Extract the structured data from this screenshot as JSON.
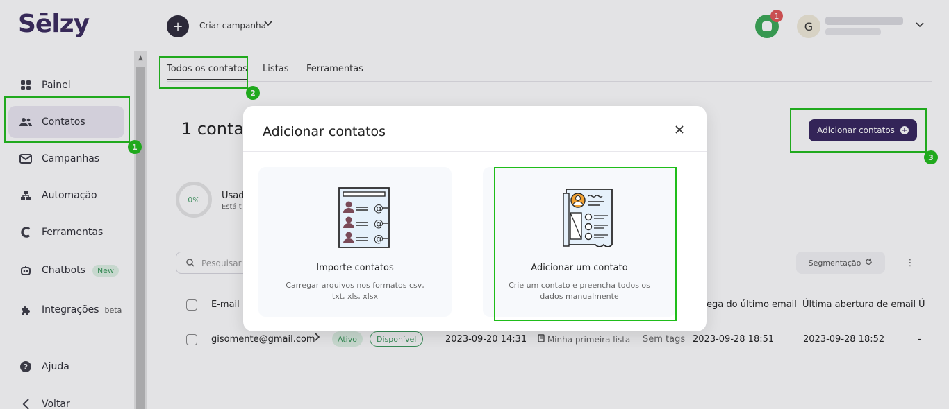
{
  "brand": {
    "logo_text": "Sēlzy"
  },
  "sidebar": {
    "items": [
      {
        "label": "Painel",
        "icon": "grid-icon"
      },
      {
        "label": "Contatos",
        "icon": "users-icon"
      },
      {
        "label": "Campanhas",
        "icon": "mail-icon"
      },
      {
        "label": "Automação",
        "icon": "flow-icon"
      },
      {
        "label": "Ferramentas",
        "icon": "tools-icon"
      },
      {
        "label": "Chatbots",
        "icon": "bot-icon",
        "badge": "New"
      },
      {
        "label": "Integrações",
        "icon": "puzzle-icon",
        "badge": "beta"
      },
      {
        "label": "Ajuda",
        "icon": "help-icon"
      },
      {
        "label": "Voltar",
        "icon": "back-icon"
      }
    ]
  },
  "topbar": {
    "create_label": "Criar campanha",
    "notification_count": "1",
    "avatar_initial": "G"
  },
  "tabs": [
    "Todos os contatos",
    "Listas",
    "Ferramentas"
  ],
  "main": {
    "heading": "1 conta",
    "add_button": "Adicionar contatos",
    "usage": {
      "percent": "0%",
      "title": "Usad",
      "sub": "Está t"
    },
    "search_placeholder": "Pesquisar",
    "segmentation": "Segmentação"
  },
  "table": {
    "columns": [
      "E-mail",
      "rega do último email",
      "Última abertura de email",
      "Ú"
    ],
    "row": {
      "email": "gisomente@gmail.com",
      "status": "Ativo",
      "availability": "Disponível",
      "date_added": "2023-09-20 14:31",
      "list": "Minha primeira lista",
      "tags": "Sem tags",
      "last_delivery": "2023-09-28 18:51",
      "last_open": "2023-09-28 18:52",
      "last_col": "-"
    }
  },
  "modal": {
    "title": "Adicionar contatos",
    "options": [
      {
        "title": "Importe contatos",
        "desc": "Carregar arquivos nos formatos csv, txt, xls, xlsx"
      },
      {
        "title": "Adicionar um contato",
        "desc": "Crie um contato e preencha todos os dados manualmente"
      }
    ]
  },
  "annotations": [
    "1",
    "2",
    "3"
  ],
  "colors": {
    "brand": "#35245e",
    "highlight": "#1fbd1a",
    "success": "#3c9a5c"
  }
}
